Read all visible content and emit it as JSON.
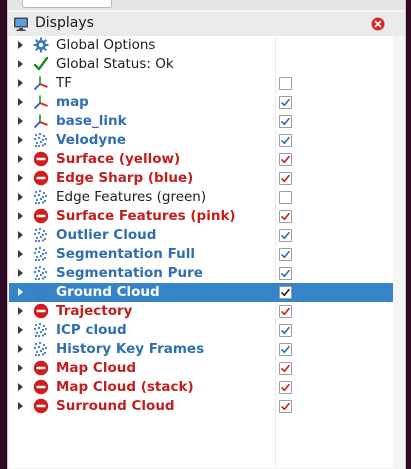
{
  "panel": {
    "title": "Displays",
    "colors": {
      "selection": "#3584c8",
      "blue_text": "#2f6fb0",
      "red_text": "#c21f1f",
      "status_ok": "#1f8a1f",
      "error": "#d01c1c"
    }
  },
  "rows": [
    {
      "label": "Global Options",
      "icon": "gear-icon",
      "style": "plain",
      "check": null
    },
    {
      "label": "Global Status: Ok",
      "icon": "checkmark-icon",
      "style": "plain",
      "check": null
    },
    {
      "label": "TF",
      "icon": "axes-icon",
      "style": "plain",
      "check": false
    },
    {
      "label": "map",
      "icon": "axes-icon",
      "style": "blue",
      "check": true
    },
    {
      "label": "base_link",
      "icon": "axes-icon",
      "style": "blue",
      "check": true
    },
    {
      "label": "Velodyne",
      "icon": "point-cloud-icon",
      "style": "blue",
      "check": true
    },
    {
      "label": "Surface (yellow)",
      "icon": "error-icon",
      "style": "red",
      "check": true
    },
    {
      "label": "Edge Sharp (blue)",
      "icon": "error-icon",
      "style": "red",
      "check": true
    },
    {
      "label": "Edge Features (green)",
      "icon": "point-cloud-icon",
      "style": "plain",
      "check": false
    },
    {
      "label": "Surface Features (pink)",
      "icon": "error-icon",
      "style": "red",
      "check": true
    },
    {
      "label": "Outlier Cloud",
      "icon": "point-cloud-icon",
      "style": "blue",
      "check": true
    },
    {
      "label": "Segmentation Full",
      "icon": "point-cloud-icon",
      "style": "blue",
      "check": true
    },
    {
      "label": "Segmentation Pure",
      "icon": "point-cloud-icon",
      "style": "blue",
      "check": true
    },
    {
      "label": "Ground Cloud",
      "icon": "point-cloud-icon",
      "style": "selected",
      "check": true
    },
    {
      "label": "Trajectory",
      "icon": "error-icon",
      "style": "red",
      "check": true
    },
    {
      "label": "ICP cloud",
      "icon": "point-cloud-icon",
      "style": "blue",
      "check": true
    },
    {
      "label": "History Key Frames",
      "icon": "point-cloud-icon",
      "style": "blue",
      "check": true
    },
    {
      "label": "Map Cloud",
      "icon": "error-icon",
      "style": "red",
      "check": true
    },
    {
      "label": "Map Cloud (stack)",
      "icon": "error-icon",
      "style": "red",
      "check": true
    },
    {
      "label": "Surround Cloud",
      "icon": "error-icon",
      "style": "red",
      "check": true
    }
  ]
}
